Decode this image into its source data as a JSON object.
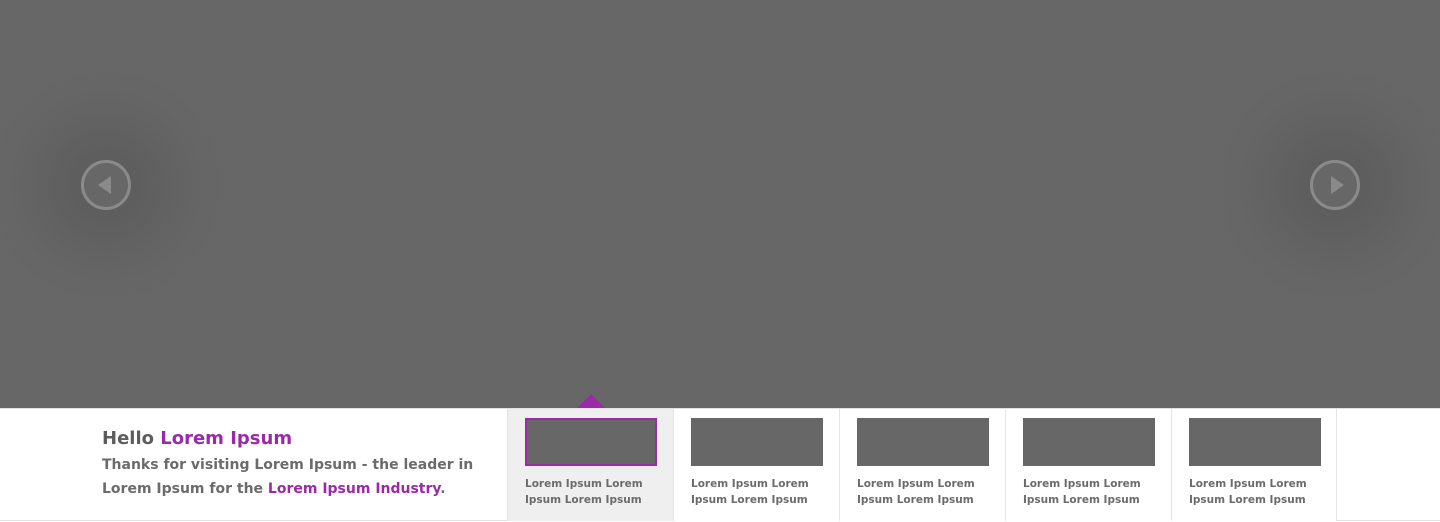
{
  "colors": {
    "accent": "#9b2aa6",
    "hero_background": "#676767",
    "text": "#5d5d5d"
  },
  "slider": {
    "prev_icon": "chevron-left-circle-icon",
    "next_icon": "chevron-right-circle-icon"
  },
  "intro": {
    "title_prefix": "Hello",
    "title_highlight": "Lorem Ipsum",
    "text_part1": "Thanks for visiting Lorem Ipsum - the leader in Lorem Ipsum for the",
    "text_highlight": "Lorem Ipsum Industry",
    "text_end": "."
  },
  "thumbnails": [
    {
      "caption": "Lorem Ipsum Lorem Ipsum Lorem Ipsum",
      "active": true
    },
    {
      "caption": "Lorem Ipsum Lorem Ipsum Lorem Ipsum",
      "active": false
    },
    {
      "caption": "Lorem Ipsum Lorem Ipsum Lorem Ipsum",
      "active": false
    },
    {
      "caption": "Lorem Ipsum Lorem Ipsum Lorem Ipsum",
      "active": false
    },
    {
      "caption": "Lorem Ipsum Lorem Ipsum Lorem Ipsum",
      "active": false
    }
  ]
}
